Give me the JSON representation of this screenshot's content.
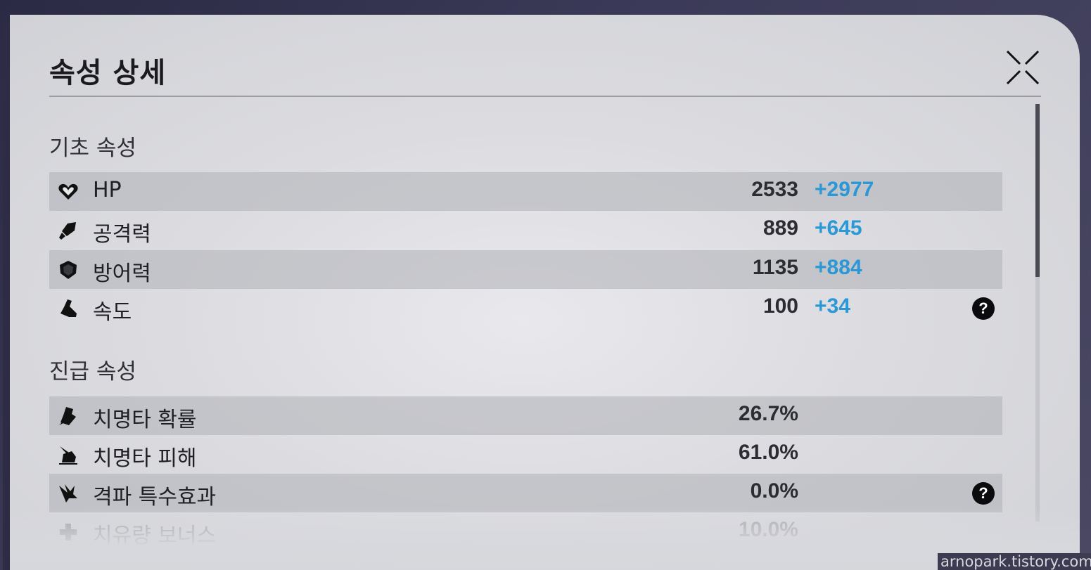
{
  "header": {
    "title": "속성 상세"
  },
  "basic": {
    "heading": "기초 속성",
    "rows": [
      {
        "name": "HP",
        "value": "2533",
        "bonus": "+2977",
        "icon": "heart-icon"
      },
      {
        "name": "공격력",
        "value": "889",
        "bonus": "+645",
        "icon": "sword-icon"
      },
      {
        "name": "방어력",
        "value": "1135",
        "bonus": "+884",
        "icon": "shield-icon"
      },
      {
        "name": "속도",
        "value": "100",
        "bonus": "+34",
        "icon": "boot-icon",
        "help": "?"
      }
    ]
  },
  "advanced": {
    "heading": "진급 속성",
    "rows": [
      {
        "name": "치명타 확률",
        "value": "26.7%",
        "icon": "crit-rate-icon"
      },
      {
        "name": "치명타 피해",
        "value": "61.0%",
        "icon": "crit-damage-icon"
      },
      {
        "name": "격파 특수효과",
        "value": "0.0%",
        "icon": "break-effect-icon",
        "help": "?"
      },
      {
        "name": "치유량 보너스",
        "value": "10.0%",
        "icon": "healing-icon"
      }
    ]
  },
  "watermark": "arnopark.tistory.com",
  "colors": {
    "bonus": "#2a98d6",
    "row_shade": "#b9bac0",
    "title": "#1b1b1f"
  }
}
